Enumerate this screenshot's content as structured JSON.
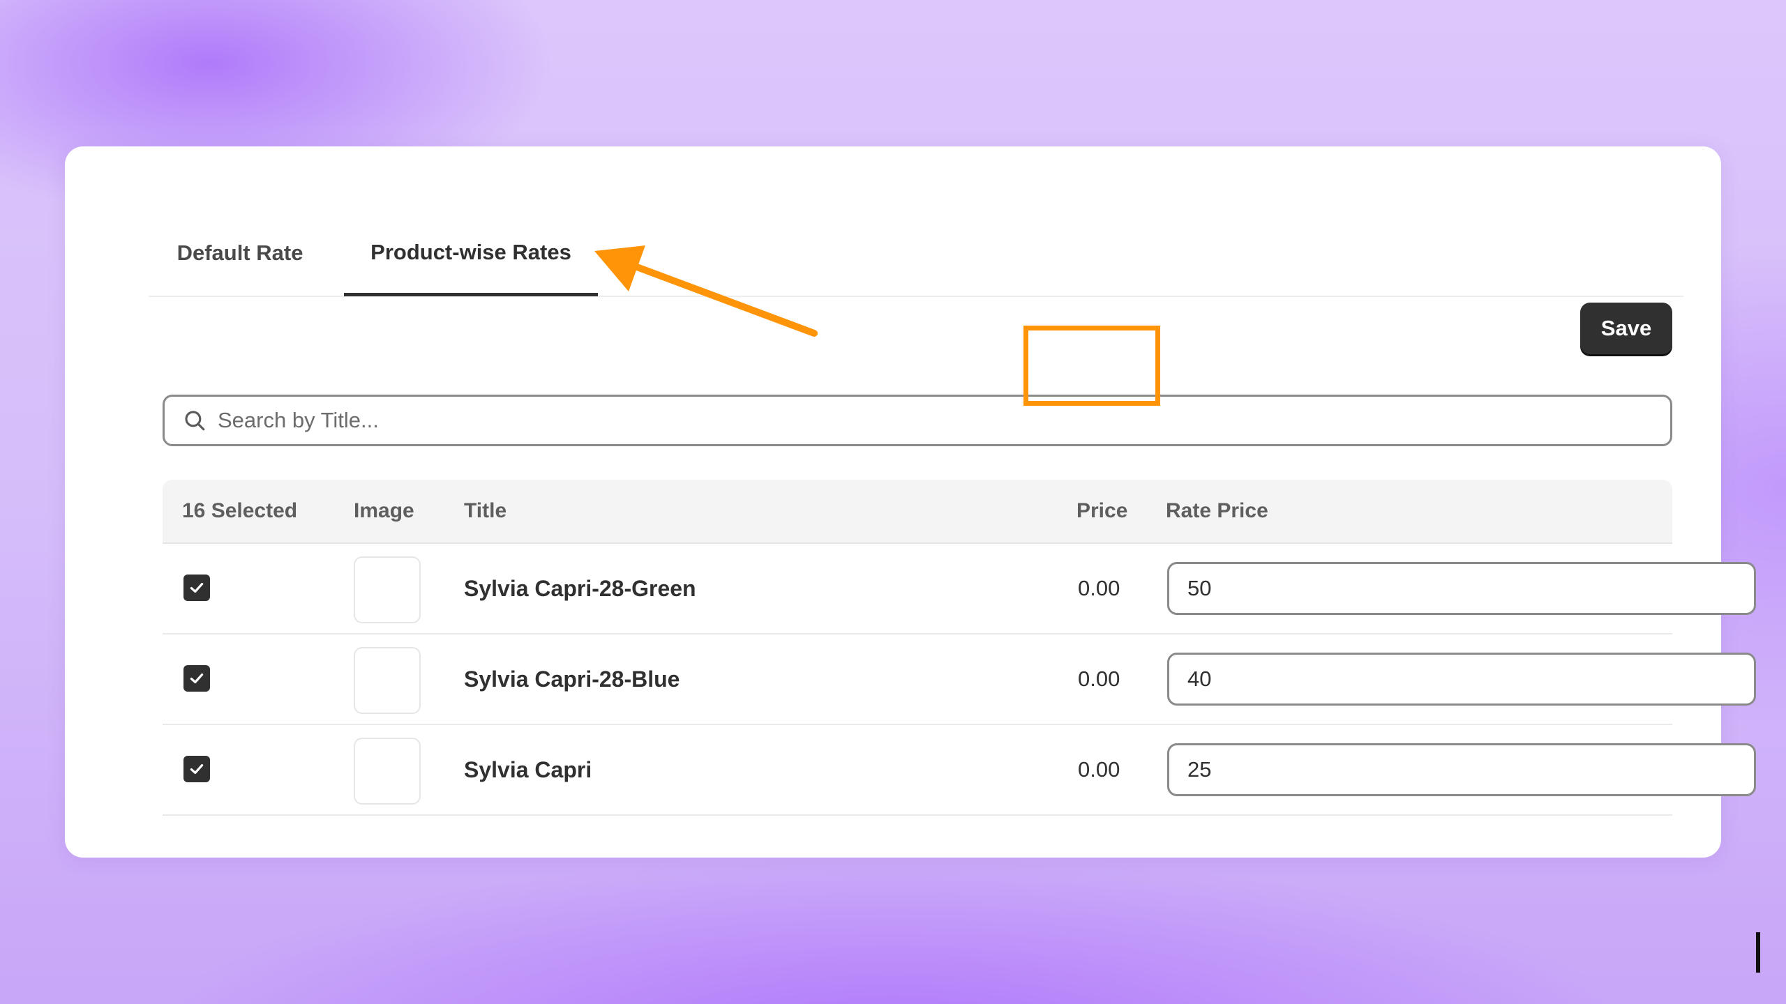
{
  "tabs": [
    {
      "label": "Default Rate",
      "active": false
    },
    {
      "label": "Product-wise Rates",
      "active": true
    }
  ],
  "toolbar": {
    "save_label": "Save"
  },
  "search": {
    "placeholder": "Search by Title...",
    "value": ""
  },
  "table": {
    "columns": {
      "selected": "16 Selected",
      "image": "Image",
      "title": "Title",
      "price": "Price",
      "rate_price": "Rate Price"
    },
    "rows": [
      {
        "checked": true,
        "title": "Sylvia Capri-28-Green",
        "price": "0.00",
        "rate_price": "50"
      },
      {
        "checked": true,
        "title": "Sylvia Capri-28-Blue",
        "price": "0.00",
        "rate_price": "40"
      },
      {
        "checked": true,
        "title": "Sylvia Capri",
        "price": "0.00",
        "rate_price": "25"
      }
    ]
  },
  "annotations": {
    "accent_color": "#ff9408",
    "arrow_target": "Product-wise Rates",
    "highlight_target": "Rate Price"
  },
  "icons": {
    "search": "search-icon",
    "checkbox": "checkmark-icon"
  }
}
